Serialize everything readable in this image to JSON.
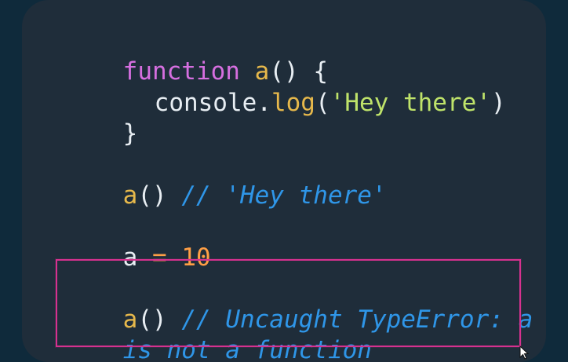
{
  "code": {
    "line1": {
      "keyword": "function",
      "name": "a",
      "paren": "()",
      "brace": "{"
    },
    "line2": {
      "object": "console",
      "dot": ".",
      "method": "log",
      "open": "(",
      "string": "'Hey there'",
      "close": ")"
    },
    "line3": {
      "brace": "}"
    },
    "line4": {
      "call": "a",
      "paren": "()",
      "comment": "// 'Hey there'"
    },
    "line5": {
      "var": "a",
      "op": "=",
      "num": "10"
    },
    "line6": {
      "call": "a",
      "paren": "()",
      "comment": "// Uncaught TypeError: a"
    },
    "line7": {
      "comment": "is not a function"
    }
  },
  "colors": {
    "background": "#0f2a3b",
    "panel": "#1f2d3a",
    "highlight_border": "#d6318f",
    "keyword": "#d66fe0",
    "function_name": "#e6b84b",
    "string": "#bfe36a",
    "number": "#ff9f45",
    "comment": "#2f96e8",
    "text": "#e8eef3"
  },
  "icons": {
    "cursor": "mouse-pointer-icon"
  }
}
